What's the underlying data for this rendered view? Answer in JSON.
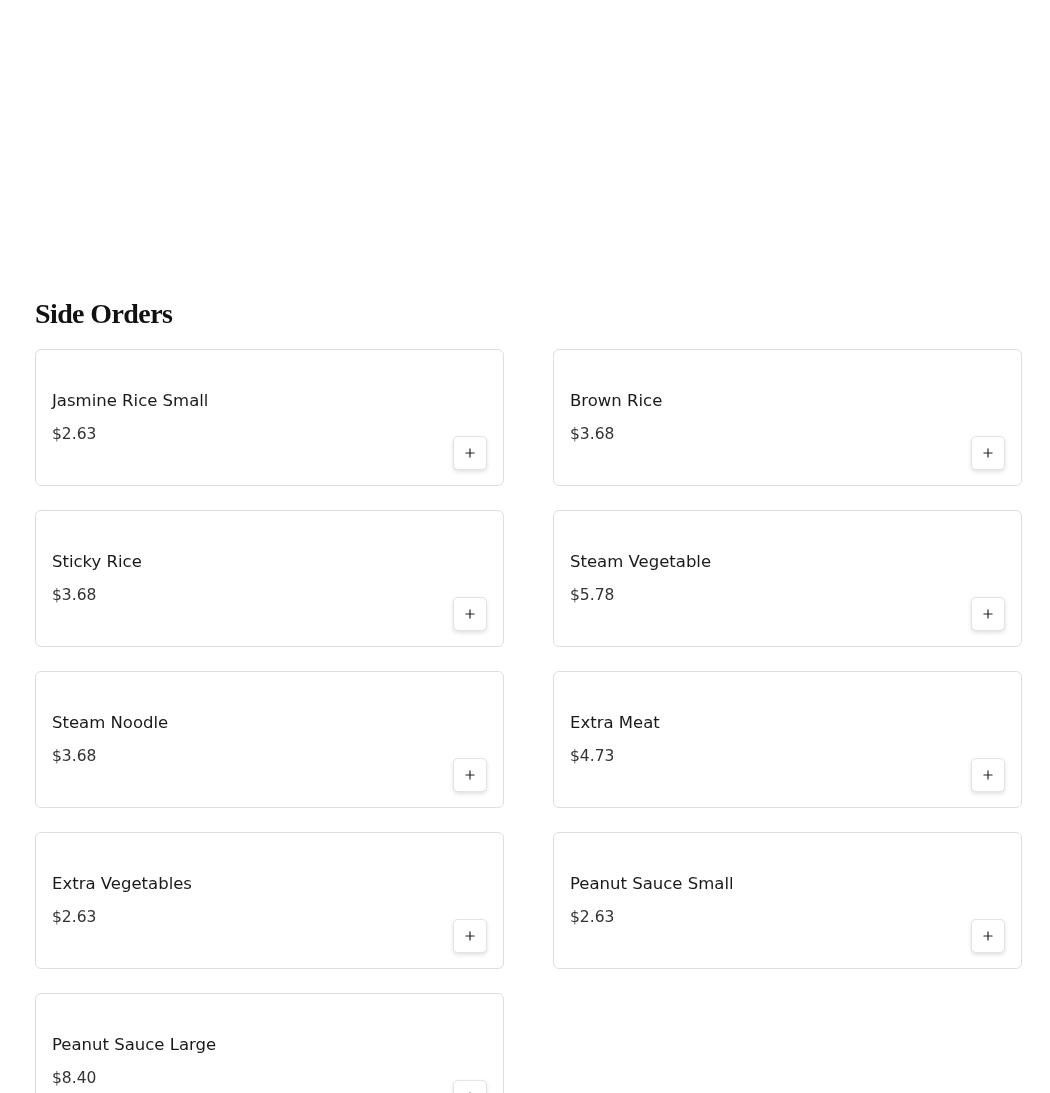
{
  "section": {
    "title": "Side Orders"
  },
  "items": [
    {
      "name": "Jasmine Rice Small",
      "price": "$2.63"
    },
    {
      "name": "Brown Rice",
      "price": "$3.68"
    },
    {
      "name": "Sticky Rice",
      "price": "$3.68"
    },
    {
      "name": "Steam Vegetable",
      "price": "$5.78"
    },
    {
      "name": "Steam Noodle",
      "price": "$3.68"
    },
    {
      "name": "Extra Meat",
      "price": "$4.73"
    },
    {
      "name": "Extra Vegetables",
      "price": "$2.63"
    },
    {
      "name": "Peanut Sauce Small",
      "price": "$2.63"
    },
    {
      "name": "Peanut Sauce Large",
      "price": "$8.40"
    }
  ]
}
